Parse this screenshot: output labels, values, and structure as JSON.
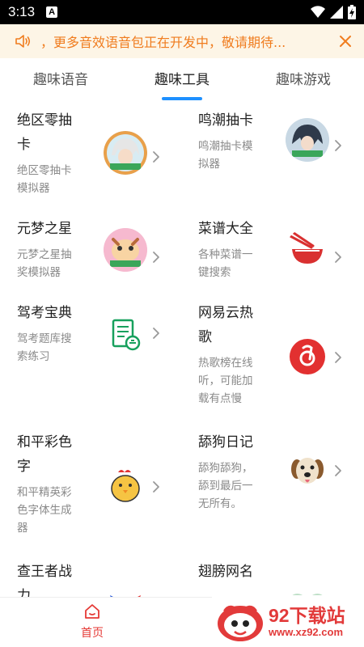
{
  "status_bar": {
    "time": "3:13",
    "indicator": "A"
  },
  "notice": {
    "text": "，更多音效语音包正在开发中，敬请期待..."
  },
  "tabs": [
    {
      "label": "趣味语音"
    },
    {
      "label": "趣味工具",
      "active": true
    },
    {
      "label": "趣味游戏"
    }
  ],
  "items": [
    {
      "title": "绝区零抽卡",
      "desc": "绝区零抽卡模拟器",
      "icon": "anime-girl-icon"
    },
    {
      "title": "鸣潮抽卡",
      "desc": "鸣潮抽卡模拟器",
      "icon": "anime-character-icon"
    },
    {
      "title": "元梦之星",
      "desc": "元梦之星抽奖模拟器",
      "icon": "cute-creature-icon"
    },
    {
      "title": "菜谱大全",
      "desc": "各种菜谱一键搜索",
      "icon": "noodle-bowl-icon"
    },
    {
      "title": "驾考宝典",
      "desc": "驾考题库搜索练习",
      "icon": "driving-test-icon"
    },
    {
      "title": "网易云热歌",
      "desc": "热歌榜在线听，可能加载有点慢",
      "icon": "netease-music-icon"
    },
    {
      "title": "和平彩色字",
      "desc": "和平精英彩色字体生成器",
      "icon": "chick-icon"
    },
    {
      "title": "舔狗日记",
      "desc": "舔狗舔狗，舔到最后一无所有。",
      "icon": "dog-icon"
    },
    {
      "title": "查王者战力",
      "desc": "",
      "icon": "glory-icon"
    },
    {
      "title": "翅膀网名",
      "desc": "",
      "icon": "wings-icon"
    }
  ],
  "bottom_nav": {
    "home_label": "首页"
  },
  "watermark": {
    "title": "92下载站",
    "url": "www.xz92.com"
  },
  "colors": {
    "accent": "#1e90ff",
    "notice": "#f07c1e",
    "home": "#e53935"
  }
}
